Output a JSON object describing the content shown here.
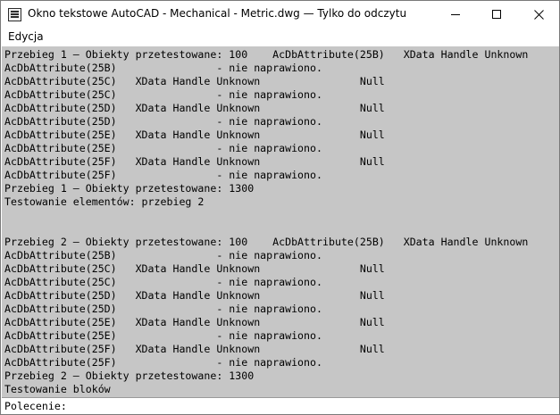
{
  "window": {
    "title": "Okno tekstowe AutoCAD - Mechanical - Metric.dwg — Tylko do odczytu"
  },
  "menu": {
    "items": [
      {
        "label": "Edycja"
      }
    ]
  },
  "log": {
    "lines": [
      "Przebieg 1 — Obiekty przetestowane: 100    AcDbAttribute(25B)   XData Handle Unknown",
      "AcDbAttribute(25B)                - nie naprawiono.",
      "AcDbAttribute(25C)   XData Handle Unknown                Null",
      "AcDbAttribute(25C)                - nie naprawiono.",
      "AcDbAttribute(25D)   XData Handle Unknown                Null",
      "AcDbAttribute(25D)                - nie naprawiono.",
      "AcDbAttribute(25E)   XData Handle Unknown                Null",
      "AcDbAttribute(25E)                - nie naprawiono.",
      "AcDbAttribute(25F)   XData Handle Unknown                Null",
      "AcDbAttribute(25F)                - nie naprawiono.",
      "Przebieg 1 — Obiekty przetestowane: 1300",
      "Testowanie elementów: przebieg 2",
      "",
      "",
      "Przebieg 2 — Obiekty przetestowane: 100    AcDbAttribute(25B)   XData Handle Unknown",
      "AcDbAttribute(25B)                - nie naprawiono.",
      "AcDbAttribute(25C)   XData Handle Unknown                Null",
      "AcDbAttribute(25C)                - nie naprawiono.",
      "AcDbAttribute(25D)   XData Handle Unknown                Null",
      "AcDbAttribute(25D)                - nie naprawiono.",
      "AcDbAttribute(25E)   XData Handle Unknown                Null",
      "AcDbAttribute(25E)                - nie naprawiono.",
      "AcDbAttribute(25F)   XData Handle Unknown                Null",
      "AcDbAttribute(25F)                - nie naprawiono.",
      "Przebieg 2 — Obiekty przetestowane: 1300",
      "Testowanie bloków"
    ]
  },
  "command": {
    "prompt": "Polecenie:",
    "value": ""
  },
  "icons": {
    "app": "text-window-icon",
    "minimize": "minimize-icon",
    "maximize": "maximize-icon",
    "close": "close-icon"
  }
}
